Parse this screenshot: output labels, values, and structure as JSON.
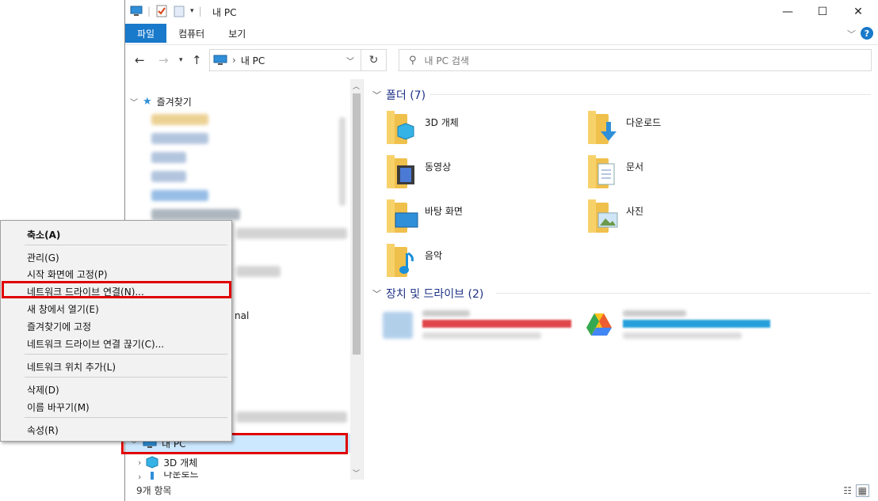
{
  "window": {
    "title": "내 PC",
    "controls": {
      "minimize": "—",
      "maximize": "☐",
      "close": "✕"
    }
  },
  "ribbon": {
    "tabs": [
      "파일",
      "컴퓨터",
      "보기"
    ],
    "help": "?"
  },
  "address": {
    "path": "내 PC",
    "search_placeholder": "내 PC 검색"
  },
  "nav_pane": {
    "quick_access": "즐겨찾기",
    "fragment_text": "nal",
    "this_pc": "내 PC",
    "child_3d": "3D 개체",
    "child_downloads": "다운로드"
  },
  "content": {
    "folders_header": "폴더 (7)",
    "folders": [
      {
        "label": "3D 개체",
        "icon": "cube-3d-icon"
      },
      {
        "label": "다운로드",
        "icon": "download-arrow-icon"
      },
      {
        "label": "동영상",
        "icon": "video-film-icon"
      },
      {
        "label": "문서",
        "icon": "document-icon"
      },
      {
        "label": "바탕 화면",
        "icon": "desktop-monitor-icon"
      },
      {
        "label": "사진",
        "icon": "picture-icon"
      },
      {
        "label": "음악",
        "icon": "music-note-icon"
      }
    ],
    "drives_header": "장치 및 드라이브 (2)"
  },
  "status_bar": {
    "item_count": "9개 항목"
  },
  "context_menu": {
    "items": [
      "축소(A)",
      "관리(G)",
      "시작 화면에 고정(P)",
      "네트워크 드라이브 연결(N)...",
      "새 창에서 열기(E)",
      "즐겨찾기에 고정",
      "네트워크 드라이브 연결 끊기(C)...",
      "네트워크 위치 추가(L)",
      "삭제(D)",
      "이름 바꾸기(M)",
      "속성(R)"
    ]
  },
  "colors": {
    "accent": "#1979ca",
    "highlight": "#e00000",
    "group_header": "#1e3287",
    "selection": "#cce8ff"
  }
}
